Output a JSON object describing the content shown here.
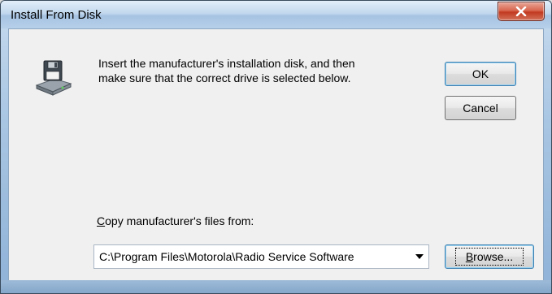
{
  "window": {
    "title": "Install From Disk"
  },
  "message": {
    "line1": "Insert the manufacturer's installation disk, and then",
    "line2": "make sure that the correct drive is selected below."
  },
  "buttons": {
    "ok_label": "OK",
    "cancel_label": "Cancel",
    "browse_label_mnemonic": "B",
    "browse_label_rest": "rowse..."
  },
  "copy_from": {
    "label_mnemonic": "C",
    "label_rest": "opy manufacturer's files from:",
    "value": "C:\\Program Files\\Motorola\\Radio Service Software"
  },
  "icons": {
    "close": "close-icon",
    "disk": "floppy-disk-drive-icon",
    "dropdown": "chevron-down-icon"
  },
  "colors": {
    "close_button": "#c0391f",
    "client_bg": "#f0f0f0",
    "title_bar": "#c2d8ee",
    "default_button_border": "#3c7fb1"
  }
}
